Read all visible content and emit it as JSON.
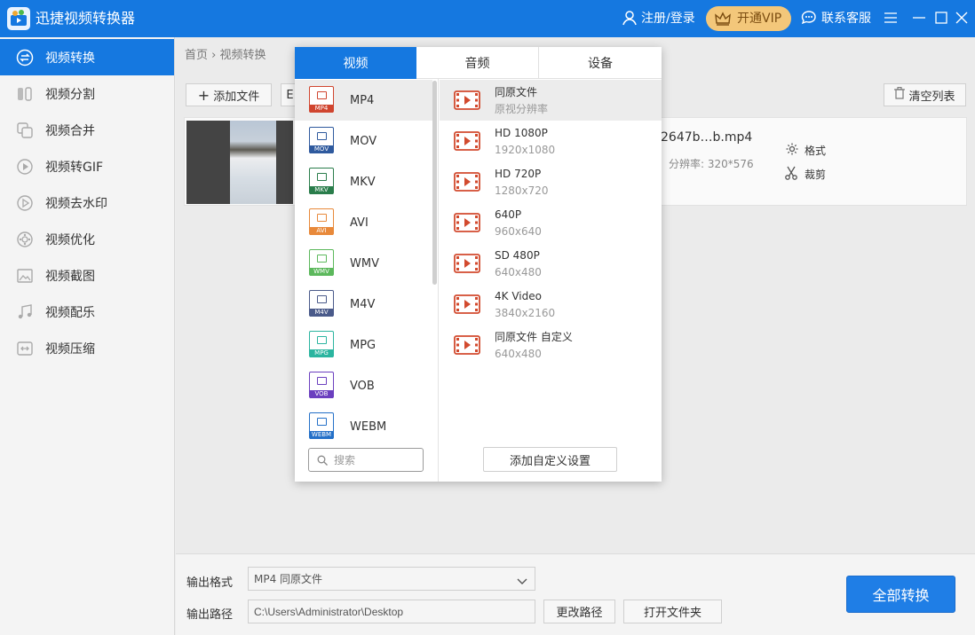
{
  "app": {
    "title": "迅捷视频转换器"
  },
  "titlebar": {
    "login": "注册/登录",
    "vip": "开通VIP",
    "support": "联系客服"
  },
  "sidebar": {
    "items": [
      {
        "label": "视频转换",
        "icon": "convert-icon"
      },
      {
        "label": "视频分割",
        "icon": "split-icon"
      },
      {
        "label": "视频合并",
        "icon": "merge-icon"
      },
      {
        "label": "视频转GIF",
        "icon": "gif-icon"
      },
      {
        "label": "视频去水印",
        "icon": "watermark-icon"
      },
      {
        "label": "视频优化",
        "icon": "optimize-icon"
      },
      {
        "label": "视频截图",
        "icon": "screenshot-icon"
      },
      {
        "label": "视频配乐",
        "icon": "music-icon"
      },
      {
        "label": "视频压缩",
        "icon": "compress-icon"
      }
    ]
  },
  "breadcrumb": {
    "home": "首页",
    "sep": "›",
    "current": "视频转换"
  },
  "toolbar": {
    "add_file": "添加文件",
    "add_folder_partial": "E",
    "clear_list": "清空列表"
  },
  "file": {
    "name": "2647b…b.mp4",
    "resolution": "分辨率: 320*576",
    "format_label": "格式",
    "crop_label": "裁剪"
  },
  "popup": {
    "tabs": [
      "视频",
      "音频",
      "设备"
    ],
    "formats": [
      "MP4",
      "MOV",
      "MKV",
      "AVI",
      "WMV",
      "M4V",
      "MPG",
      "VOB",
      "WEBM"
    ],
    "format_colors": [
      "#d0452f",
      "#2f5a9e",
      "#2a7d4b",
      "#e8893a",
      "#5cb85c",
      "#4a5a8a",
      "#2bb5a0",
      "#6b3fbf",
      "#2470c8"
    ],
    "search_placeholder": "搜索",
    "qualities": [
      {
        "name": "同原文件",
        "res": "原视分辨率"
      },
      {
        "name": "HD 1080P",
        "res": "1920x1080"
      },
      {
        "name": "HD 720P",
        "res": "1280x720"
      },
      {
        "name": "640P",
        "res": "960x640"
      },
      {
        "name": "SD 480P",
        "res": "640x480"
      },
      {
        "name": "4K Video",
        "res": "3840x2160"
      },
      {
        "name": "同原文件 自定义",
        "res": "640x480"
      }
    ],
    "add_custom": "添加自定义设置"
  },
  "output": {
    "format_label": "输出格式",
    "format_value": "MP4  同原文件",
    "path_label": "输出路径",
    "path_value": "C:\\Users\\Administrator\\Desktop",
    "change_path": "更改路径",
    "open_folder": "打开文件夹",
    "convert_all": "全部转换"
  }
}
